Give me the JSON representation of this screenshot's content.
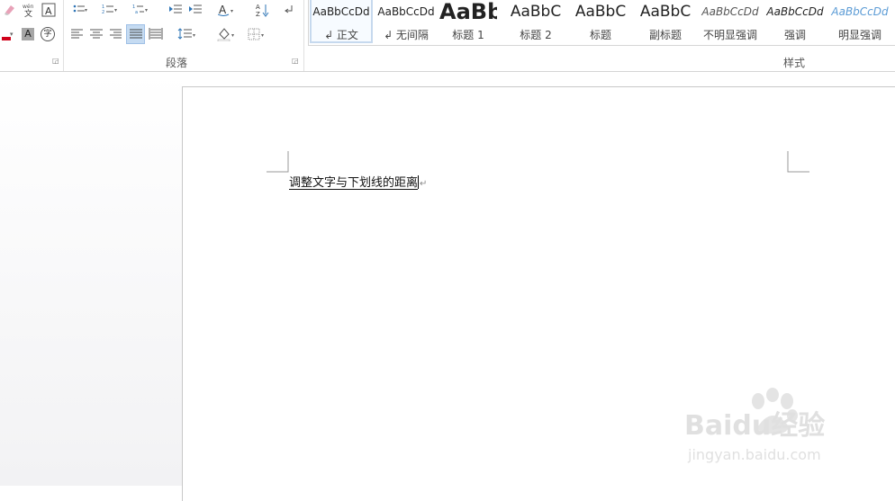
{
  "ribbon": {
    "font_group": {
      "row2_color_button": "A",
      "row2_char_shading": "A",
      "row2_enclose_char": "字"
    },
    "paragraph_group": {
      "label": "段落"
    },
    "styles_group": {
      "label": "样式",
      "items": [
        {
          "preview": "AaBbCcDd",
          "name": "↲ 正文"
        },
        {
          "preview": "AaBbCcDd",
          "name": "↲ 无间隔"
        },
        {
          "preview": "AaBb",
          "name": "标题 1"
        },
        {
          "preview": "AaBbC",
          "name": "标题 2"
        },
        {
          "preview": "AaBbC",
          "name": "标题"
        },
        {
          "preview": "AaBbC",
          "name": "副标题"
        },
        {
          "preview": "AaBbCcDd",
          "name": "不明显强调"
        },
        {
          "preview": "AaBbCcDd",
          "name": "强调"
        },
        {
          "preview": "AaBbCcDd",
          "name": "明显强调"
        }
      ]
    }
  },
  "document": {
    "text": "调整文字与下划线的距离",
    "paragraph_mark": "↵"
  },
  "watermark": {
    "brand": "Baidu经验",
    "url": "jingyan.baidu.com"
  },
  "colors": {
    "selected_button": "#c5dbf2",
    "font_color_red": "#d0021b",
    "heading_style_blue": "#5b9bd5"
  }
}
